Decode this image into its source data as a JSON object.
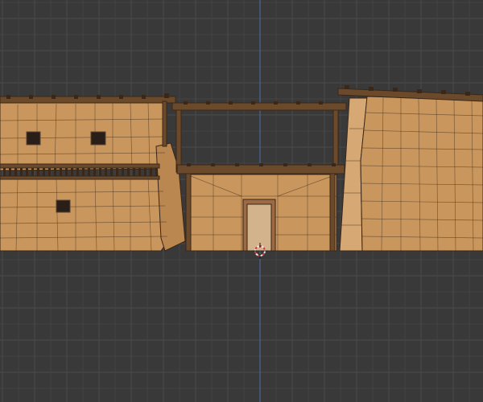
{
  "viewport": {
    "background_color": "#393939",
    "grid_minor_color": "#444444",
    "grid_major_color": "#4a4a4a",
    "axis_z_color": "#4d6fa8",
    "icons": [
      "3d-cursor-icon"
    ]
  },
  "scene": {
    "object": "adobe-building-wireframe",
    "colors": {
      "wall": "#c9975e",
      "wall_dark": "#b9874f",
      "wall_light": "#d5a874",
      "edge": "#3a2616",
      "wood": "#6b4a2c",
      "wood_dark": "#3b2717",
      "window": "#2a1f18",
      "door_frame": "#9c6b43",
      "door": "#d2b38c"
    }
  }
}
